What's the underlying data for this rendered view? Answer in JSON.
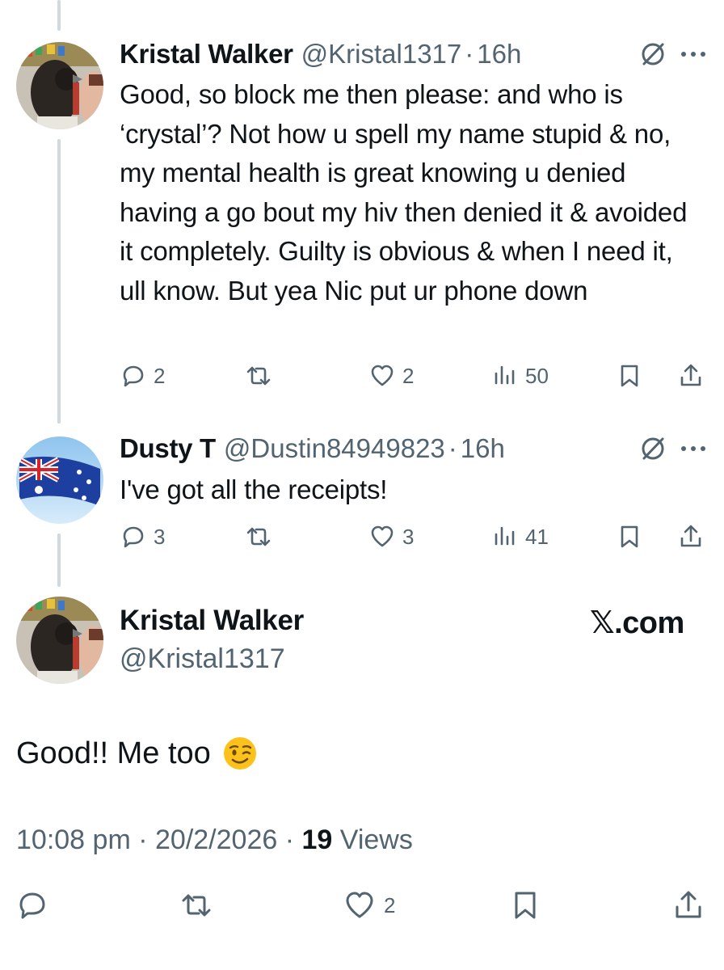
{
  "colors": {
    "text": "#0f1419",
    "secondary": "#536471",
    "thread_line": "#cfd9de",
    "background": "#ffffff"
  },
  "replies": [
    {
      "display_name": "Kristal Walker",
      "handle": "@Kristal1317",
      "separator": "·",
      "time": "16h",
      "text": "Good, so block me then please: and who is ‘crystal’? Not how u spell my name stupid & no, my mental health is great knowing u denied having a go bout my hiv then denied it & avoided it completely. Guilty is obvious & when I need it, ull know. But yea Nic put ur phone down",
      "reply_count": "2",
      "like_count": "2",
      "view_count": "50",
      "avatar_icon": "avatar-bird-photo"
    },
    {
      "display_name": "Dusty T",
      "handle": "@Dustin84949823",
      "separator": "·",
      "time": "16h",
      "text": "I've got all the receipts!",
      "reply_count": "3",
      "like_count": "3",
      "view_count": "41",
      "avatar_icon": "avatar-australian-flag"
    }
  ],
  "main_tweet": {
    "display_name": "Kristal Walker",
    "handle": "@Kristal1317",
    "brand": "𝕏.com",
    "text": "Good!! Me too",
    "emoji_icon": "winking-face-emoji",
    "time": "10:08 pm",
    "separator": "·",
    "date": "20/2/2026",
    "views_count": "19",
    "views_label": "Views",
    "like_count": "2"
  }
}
